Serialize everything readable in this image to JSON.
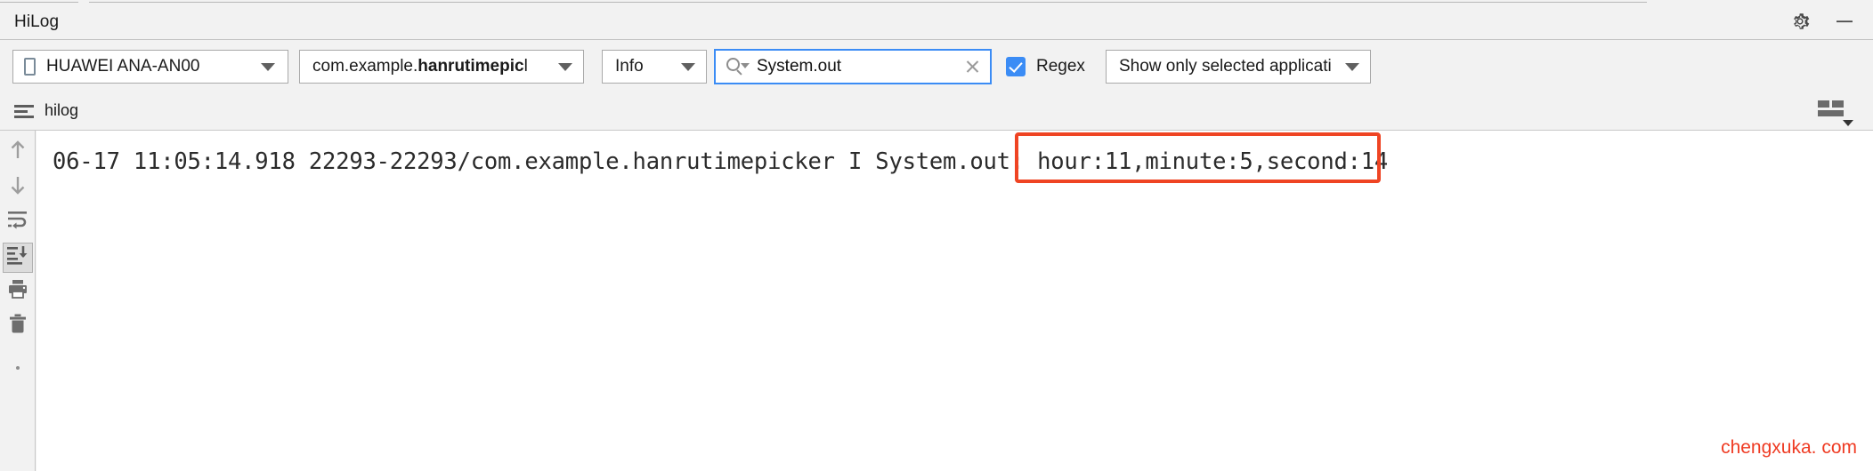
{
  "window": {
    "title": "HiLog",
    "gear_icon": "gear-icon",
    "minimize_icon": "minimize-icon"
  },
  "toolbar": {
    "device": {
      "label": "HUAWEI ANA-AN00",
      "icon": "phone-icon"
    },
    "package": {
      "prefix": "com.example.",
      "bold": "hanrutimepic",
      "suffix": "l"
    },
    "level": {
      "label": "Info"
    },
    "search": {
      "value": "System.out",
      "placeholder": "",
      "icon": "search-icon",
      "clear_icon": "close-icon"
    },
    "regex": {
      "label": "Regex",
      "checked": true
    },
    "scope": {
      "label": "Show only selected applicati"
    }
  },
  "tabbar": {
    "tab_label": "hilog",
    "tab_icon": "log-lines-icon",
    "layout_icon": "layout-grid-icon"
  },
  "rail": {
    "items": [
      {
        "name": "scroll-up-button",
        "icon": "arrow-up-icon"
      },
      {
        "name": "scroll-down-button",
        "icon": "arrow-down-icon"
      },
      {
        "name": "soft-wrap-button",
        "icon": "soft-wrap-icon"
      },
      {
        "name": "scroll-to-end-button",
        "icon": "scroll-to-end-icon",
        "selected": true
      },
      {
        "name": "print-button",
        "icon": "printer-icon"
      },
      {
        "name": "clear-log-button",
        "icon": "trash-icon"
      }
    ]
  },
  "log": {
    "line": "06-17 11:05:14.918 22293-22293/com.example.hanrutimepicker I System.out: hour:11,minute:5,second:14",
    "highlight_text": "hour:11,minute:5,second:14",
    "highlight_color": "#ef4423"
  },
  "watermark": {
    "text": "chengxuka. com",
    "color": "#ef3b23"
  }
}
